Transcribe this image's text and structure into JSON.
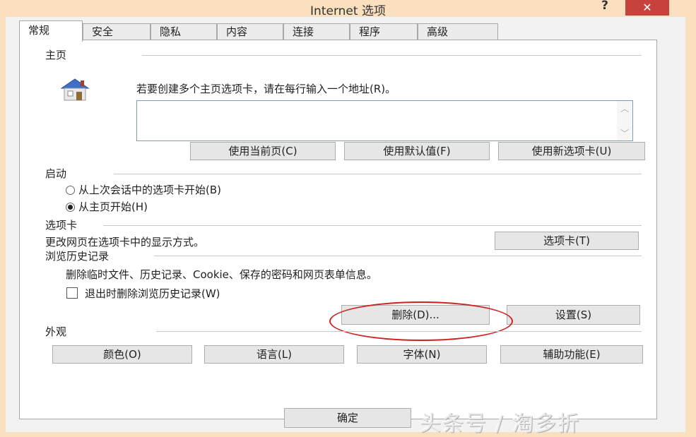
{
  "window": {
    "title": "Internet 选项",
    "help_label": "?",
    "close_label": "✕"
  },
  "tabs": [
    {
      "label": "常规",
      "active": true
    },
    {
      "label": "安全"
    },
    {
      "label": "隐私"
    },
    {
      "label": "内容"
    },
    {
      "label": "连接"
    },
    {
      "label": "程序"
    },
    {
      "label": "高级"
    }
  ],
  "home": {
    "group_title": "主页",
    "instruction": "若要创建多个主页选项卡，请在每行输入一个地址(R)。",
    "textarea_value": "",
    "buttons": {
      "use_current": "使用当前页(C)",
      "use_default": "使用默认值(F)",
      "use_new_tab": "使用新选项卡(U)"
    }
  },
  "startup": {
    "group_title": "启动",
    "options": [
      {
        "label": "从上次会话中的选项卡开始(B)",
        "checked": false
      },
      {
        "label": "从主页开始(H)",
        "checked": true
      }
    ]
  },
  "tabs_section": {
    "group_title": "选项卡",
    "description": "更改网页在选项卡中的显示方式。",
    "button": "选项卡(T)"
  },
  "history": {
    "group_title": "浏览历史记录",
    "description": "删除临时文件、历史记录、Cookie、保存的密码和网页表单信息。",
    "checkbox_label": "退出时删除浏览历史记录(W)",
    "checkbox_checked": false,
    "delete_button": "删除(D)...",
    "settings_button": "设置(S)"
  },
  "appearance": {
    "group_title": "外观",
    "buttons": {
      "colors": "颜色(O)",
      "languages": "语言(L)",
      "fonts": "字体(N)",
      "accessibility": "辅助功能(E)"
    }
  },
  "footer": {
    "ok": "确定",
    "watermark": "头条号 / 淘多折"
  },
  "colors": {
    "titlebar": "#fbe0c0",
    "close": "#c7423c",
    "annotation": "#d02020"
  }
}
